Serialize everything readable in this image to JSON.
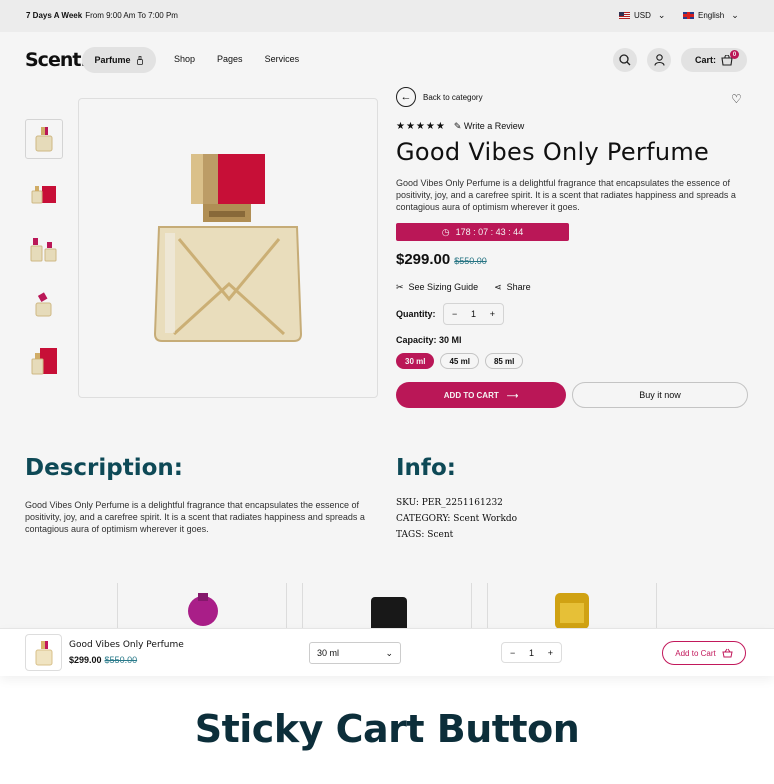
{
  "topbar": {
    "hours_bold": "7 Days A Week",
    "hours_rest": "From 9:00 Am To 7:00 Pm",
    "currency": "USD",
    "language": "English"
  },
  "header": {
    "logo": "Scent.",
    "category_pill": "Parfume",
    "nav": [
      "Shop",
      "Pages",
      "Services"
    ],
    "cart_label": "Cart:",
    "cart_count": "0"
  },
  "product": {
    "back_label": "Back to category",
    "write_review": "Write a Review",
    "stars": "★★★★★",
    "title": "Good Vibes Only Perfume",
    "description": "Good Vibes Only Perfume is a delightful fragrance that encapsulates the essence of positivity, joy, and a carefree spirit. It is a scent that radiates happiness and spreads a contagious aura of optimism wherever it goes.",
    "timer": "178 : 07 : 43 : 44",
    "price": "$299.00",
    "old_price": "$550.00",
    "sizing_guide": "See Sizing Guide",
    "share": "Share",
    "quantity_label": "Quantity:",
    "quantity": "1",
    "capacity_label": "Capacity: 30 Ml",
    "capacities": [
      "30 ml",
      "45 ml",
      "85 ml"
    ],
    "add_to_cart": "ADD TO CART",
    "buy_now": "Buy it now"
  },
  "description_section": {
    "heading": "Description:",
    "body": "Good Vibes Only Perfume is a delightful fragrance that encapsulates the essence of positivity, joy, and a carefree spirit. It is a scent that radiates happiness and spreads a contagious aura of optimism wherever it goes."
  },
  "info_section": {
    "heading": "Info:",
    "sku_label": "SKU:",
    "sku": "PER_2251161232",
    "category_label": "CATEGORY:",
    "category": "Scent Workdo",
    "tags_label": "TAGS:",
    "tags": "Scent"
  },
  "sticky_bar": {
    "name": "Good Vibes Only Perfume",
    "price": "$299.00",
    "old_price": "$550.00",
    "selected_capacity": "30 ml",
    "quantity": "1",
    "add_to_cart": "Add to Cart"
  },
  "footer": {
    "title": "Sticky Cart Button"
  },
  "colors": {
    "accent": "#c2185b",
    "heading": "#0f4d5a",
    "footer_title": "#0c2e3a",
    "old_price": "#2a7a8a"
  },
  "icons": [
    "search-icon",
    "user-icon",
    "cart-icon",
    "heart-icon",
    "arrow-left-icon",
    "pencil-icon",
    "clock-icon",
    "scissors-icon",
    "share-icon",
    "arrow-right-icon",
    "basket-icon",
    "chevron-down-icon"
  ]
}
